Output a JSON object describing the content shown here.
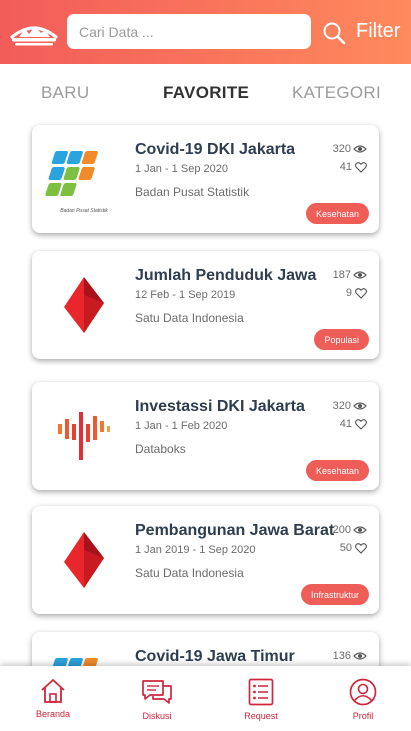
{
  "header": {
    "search_placeholder": "Cari Data ...",
    "filter_label": "Filter"
  },
  "tabs": [
    {
      "label": "BARU",
      "active": false
    },
    {
      "label": "FAVORITE",
      "active": true
    },
    {
      "label": "KATEGORI",
      "active": false
    }
  ],
  "cards": [
    {
      "title": "Covid-19 DKI Jakarta",
      "date": "1 Jan - 1 Sep 2020",
      "source": "Badan Pusat Statistik",
      "views": "320",
      "likes": "41",
      "category": "Kesehatan",
      "logo": "bps-logo",
      "logo_caption": "Badan Pusat Statistik"
    },
    {
      "title": "Jumlah Penduduk Jawa",
      "date": "12 Feb - 1 Sep 2019",
      "source": "Satu Data Indonesia",
      "views": "187",
      "likes": "9",
      "category": "Populasi",
      "logo": "satu-data-logo"
    },
    {
      "title": "Investassi DKI Jakarta",
      "date": "1 Jan - 1 Feb 2020",
      "source": "Databoks",
      "views": "320",
      "likes": "41",
      "category": "Kesehatan",
      "logo": "databoks-logo"
    },
    {
      "title": "Pembangunan Jawa Barat",
      "date": "1 Jan 2019 - 1 Sep 2020",
      "source": "Satu Data Indonesia",
      "views": "200",
      "likes": "50",
      "category": "Infrastruktur",
      "logo": "satu-data-logo"
    },
    {
      "title": "Covid-19 Jawa Timur",
      "views": "136",
      "logo": "bps-logo"
    }
  ],
  "nav": [
    {
      "label": "Beranda",
      "icon": "home-icon"
    },
    {
      "label": "Diskusi",
      "icon": "chat-icon"
    },
    {
      "label": "Request",
      "icon": "list-icon"
    },
    {
      "label": "Profil",
      "icon": "profile-icon"
    }
  ],
  "colors": {
    "header_start": "#f25c5a",
    "header_end": "#ff8a5c",
    "badge": "#ef5d58",
    "nav": "#d1253c",
    "title": "#2e3d4f"
  }
}
